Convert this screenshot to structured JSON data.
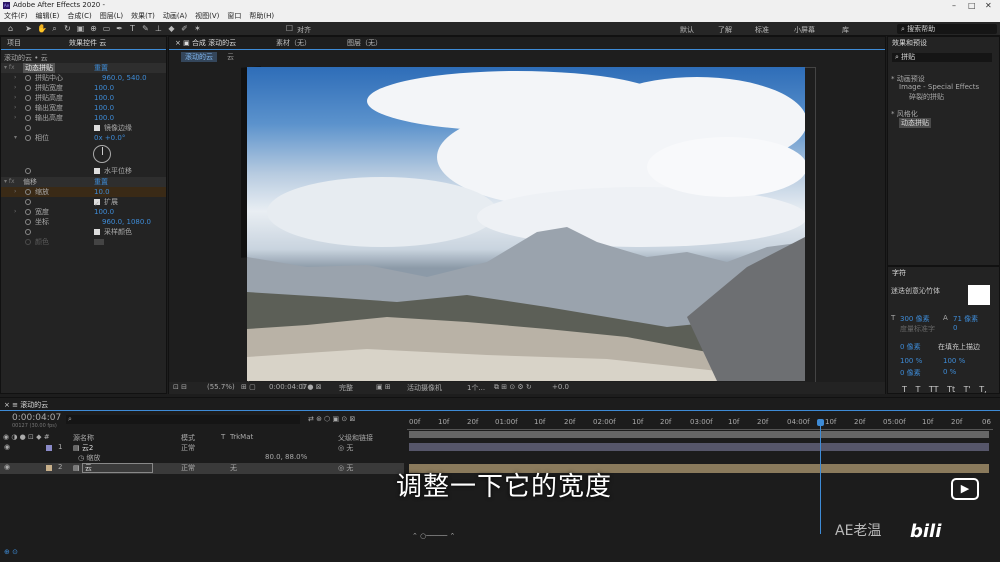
{
  "app": {
    "title": "Adobe After Effects 2020 -"
  },
  "menu": [
    "文件(F)",
    "编辑(E)",
    "合成(C)",
    "图层(L)",
    "效果(T)",
    "动画(A)",
    "视图(V)",
    "窗口",
    "帮助(H)"
  ],
  "toolbar": {
    "align_label": "对齐",
    "workspaces": [
      "默认",
      "了解",
      "标准",
      "小屏幕",
      "库"
    ],
    "search_help": "搜索帮助"
  },
  "project_panel": {
    "tab_project": "项目",
    "tab_effects_controls": "效果控件 云",
    "breadcrumb": "滚动的云 • 云",
    "effect1": {
      "name": "动态拼贴",
      "reset": "重置",
      "props": [
        {
          "label": "拼贴中心",
          "value": "960.0, 540.0"
        },
        {
          "label": "拼贴宽度",
          "value": "100.0"
        },
        {
          "label": "拼贴高度",
          "value": "100.0"
        },
        {
          "label": "输出宽度",
          "value": "100.0"
        },
        {
          "label": "输出高度",
          "value": "100.0"
        },
        {
          "label": "",
          "checkbox_label": "镜像边缘"
        },
        {
          "label": "相位",
          "value": "0x +0.0°"
        },
        {
          "label": "",
          "checkbox_label": "水平位移"
        }
      ]
    },
    "effect2": {
      "name": "偏移",
      "reset": "重置",
      "props": [
        {
          "label": "缩放",
          "value": "10.0"
        },
        {
          "label": "",
          "checkbox_label": "扩展"
        },
        {
          "label": "宽度",
          "value": "100.0"
        },
        {
          "label": "坐标",
          "value": "960.0, 1080.0"
        },
        {
          "label": "",
          "checkbox_label": "采样颜色"
        },
        {
          "label": "颜色",
          "value": ""
        }
      ]
    }
  },
  "composition_panel": {
    "tab_comp": "合成 滚动的云",
    "tab_footage": "素材（无）",
    "tab_layer": "图层（无）",
    "breadcrumb": [
      "滚动的云",
      "云"
    ],
    "zoom": "(55.7%)",
    "timecode": "0:00:04:07",
    "resolution": "完整",
    "camera": "活动摄像机",
    "views": "1个...",
    "exposure": "+0.0"
  },
  "effects_panel": {
    "title": "效果和预设",
    "search_value": "拼贴",
    "tree": [
      {
        "label": "* 动画预设",
        "indent": 0
      },
      {
        "label": "Image - Special Effects",
        "indent": 1
      },
      {
        "label": "碎裂的拼贴",
        "indent": 2
      },
      {
        "label": "* 风格化",
        "indent": 0
      },
      {
        "label": "动态拼贴",
        "indent": 1
      }
    ]
  },
  "character_panel": {
    "title": "字符",
    "font": "迷迭创意沁竹体",
    "size": "300 像素",
    "leading": "71 像素",
    "kerning": "度量标准字",
    "tracking": "0",
    "stroke": "0 像素",
    "stroke_type": "在填充上描边",
    "vscale": "100 %",
    "hscale": "100 %",
    "baseline": "0 像素",
    "tsume": "0 %",
    "styles": [
      "T",
      "T",
      "TT",
      "Tt",
      "T'",
      "T,"
    ]
  },
  "timeline": {
    "comp_name": "滚动的云",
    "timecode": "0:00:04:07",
    "frames": "00127 (30.00 fps)",
    "columns": {
      "source": "源名称",
      "mode": "模式",
      "t": "T",
      "trkmat": "TrkMat",
      "parent": "父级和链接"
    },
    "ruler": [
      "00f",
      "10f",
      "20f",
      "01:00f",
      "10f",
      "20f",
      "02:00f",
      "10f",
      "20f",
      "03:00f",
      "10f",
      "20f",
      "04:00f",
      "10f",
      "20f",
      "05:00f",
      "10f",
      "20f",
      "06"
    ],
    "layers": [
      {
        "num": "1",
        "name": "云2",
        "mode": "正常",
        "trkmat": "",
        "parent": "无"
      },
      {
        "num": "",
        "name": "缩放",
        "mode": "",
        "trkmat": "",
        "parent": "",
        "value": "80.0, 88.0%"
      },
      {
        "num": "2",
        "name": "云",
        "mode": "正常",
        "trkmat": "无",
        "parent": "无"
      }
    ]
  },
  "subtitle": "调整一下它的宽度",
  "watermark": "AE老温"
}
